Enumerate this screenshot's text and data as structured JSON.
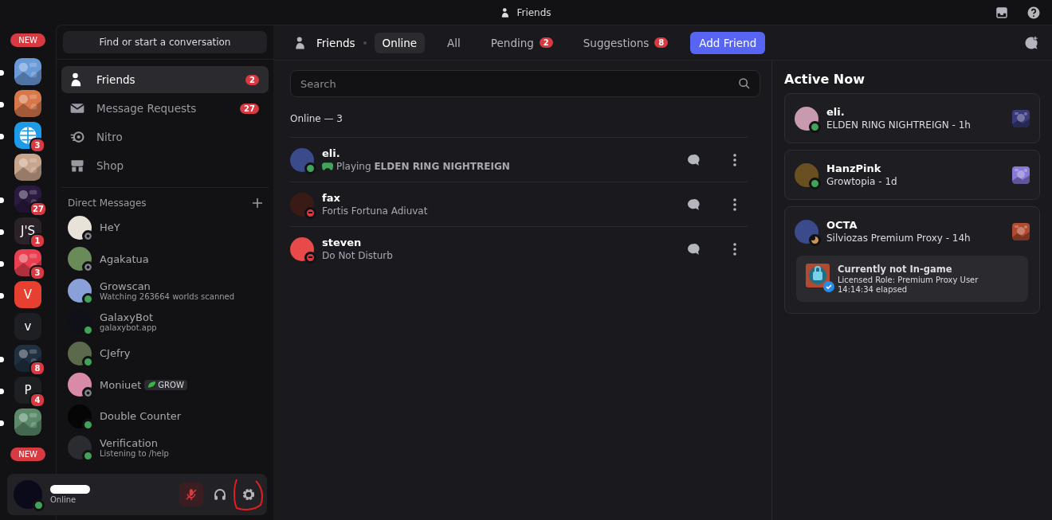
{
  "window": {
    "title": "Friends"
  },
  "servers": [
    {
      "kind": "new",
      "label": "NEW"
    },
    {
      "kind": "picture",
      "color": "#6a9ad8",
      "unread": true
    },
    {
      "kind": "picture",
      "color": "#d8774a",
      "unread": true
    },
    {
      "kind": "globe",
      "color": "#1e9be8",
      "unread": true,
      "badge": "3"
    },
    {
      "kind": "picture",
      "color": "#c8a58c",
      "unread": false
    },
    {
      "kind": "picture",
      "color": "#2a1a40",
      "unread": true,
      "badge": "27"
    },
    {
      "kind": "text",
      "label": "J'S",
      "color": "#2a2228",
      "unread": true,
      "badge": "1"
    },
    {
      "kind": "picture",
      "color": "#e84050",
      "unread": true,
      "badge": "3"
    },
    {
      "kind": "text",
      "label": "V",
      "color": "#e84030",
      "unread": true
    },
    {
      "kind": "text",
      "label": "v",
      "color": "#1e1f22",
      "unread": false
    },
    {
      "kind": "picture",
      "color": "#203040",
      "unread": true,
      "badge": "8"
    },
    {
      "kind": "text",
      "label": "P",
      "color": "#1e1f22",
      "unread": true,
      "badge": "4"
    },
    {
      "kind": "picture",
      "color": "#5a8a6a",
      "unread": true
    },
    {
      "kind": "new",
      "label": "NEW"
    }
  ],
  "sidebar": {
    "search": "Find or start a conversation",
    "items": [
      {
        "kind": "friends",
        "label": "Friends",
        "selected": true,
        "badge": "2"
      },
      {
        "kind": "mail",
        "label": "Message Requests",
        "selected": false,
        "badge": "27"
      },
      {
        "kind": "nitro",
        "label": "Nitro",
        "selected": false
      },
      {
        "kind": "shop",
        "label": "Shop",
        "selected": false
      }
    ],
    "dm_header": "Direct Messages"
  },
  "dms": [
    {
      "name": "HeY",
      "offline": true,
      "color": "#82838b"
    },
    {
      "name": "Agakatua",
      "offline": true,
      "color": "#82838b"
    },
    {
      "name": "Growscan",
      "subtitle": "Watching 263664 worlds scanned",
      "offline": false,
      "color": "#43a25a"
    },
    {
      "name": "GalaxyBot",
      "subtitle": "galaxybot.app",
      "offline": false,
      "color": "#43a25a"
    },
    {
      "name": "CJefry",
      "offline": false,
      "color": "#43a25a"
    },
    {
      "name": "Moniuet",
      "tag": "GROW",
      "offline": true,
      "color": "#82838b"
    },
    {
      "name": "Double Counter",
      "offline": false,
      "color": "#43a25a"
    },
    {
      "name": "Verification",
      "subtitle": "Listening to /help",
      "offline": false,
      "color": "#43a25a"
    }
  ],
  "user": {
    "status_text": "Online",
    "color": "#43a25a",
    "muted": true
  },
  "tabs": [
    {
      "label": "Online",
      "selected": true
    },
    {
      "label": "All",
      "selected": false
    },
    {
      "label": "Pending",
      "selected": false,
      "badge": "2"
    },
    {
      "label": "Suggestions",
      "selected": false,
      "badge": "8"
    }
  ],
  "header_title": "Friends",
  "add_friend": "Add Friend",
  "search": {
    "placeholder": "Search"
  },
  "online_header": "Online — 3",
  "friends": [
    {
      "name": "eli.",
      "activity": "Playing **ELDEN RING NIGHTREIGN**",
      "playing": true,
      "dnd": false,
      "color": "#43a25a"
    },
    {
      "name": "fax",
      "activity": "Fortis Fortuna Adiuvat",
      "playing": false,
      "dnd": true,
      "color": "#d83a42"
    },
    {
      "name": "steven",
      "activity": "Do Not Disturb",
      "playing": false,
      "dnd": true,
      "color": "#d83a42"
    }
  ],
  "active_now": {
    "title": "Active Now",
    "cards": [
      {
        "name": "eli.",
        "activity": "ELDEN RING NIGHTREIGN - 1h",
        "idle": false,
        "color": "#43a25a"
      },
      {
        "name": "HanzPink",
        "activity": "Growtopia - 1d",
        "idle": false,
        "color": "#43a25a"
      },
      {
        "name": "OCTA",
        "activity": "Silviozas Premium Proxy - 14h",
        "idle": true,
        "color": "#ca9654",
        "detail": {
          "title": "Currently not In-game",
          "line1": "Licensed Role: Premium Proxy User",
          "line2": "14:14:34 elapsed"
        }
      }
    ]
  }
}
